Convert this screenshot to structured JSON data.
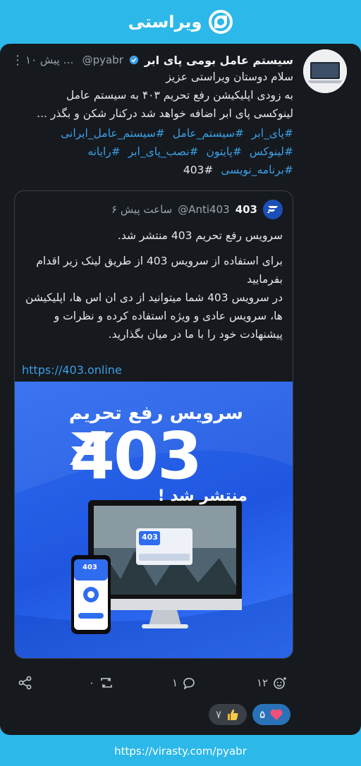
{
  "brand": {
    "name": "ویراستی"
  },
  "post": {
    "author": "سیستم عامل بومی پای ابر",
    "handle": "@pyabr",
    "time": "۱۰ ساعت پیش",
    "more_icon": "more-vertical-icon",
    "body_lines": [
      "سلام دوستان ویراستی عزیز",
      "به زودی اپلیکیشن رفع تحریم ۴۰۳ به سیستم عامل",
      "لینوکسی پای ابر اضافه خواهد شد درکنار شکن و بگذر ..."
    ],
    "hashtags": [
      "#پای_ابر",
      "#سیستم_عامل",
      "#سیستم_عامل_ایرانی",
      "#لینوکس",
      "#پایتون",
      "#نصب_پای_ابر",
      "#رایانه",
      "#برنامه_نویسی"
    ],
    "last_tag": "#403"
  },
  "quote": {
    "name": "403",
    "handle": "@Anti403",
    "time": "۶ ساعت پیش",
    "headline": "سرویس رفع تحریم 403 منتشر شد.",
    "para1": "برای استفاده از سرویس 403  از  طریق  لینک زیر اقدام بفرمایید",
    "para2": "در سرویس 403 شما میتوانید از دی ان اس ها، اپلیکیشن ها، سرویس عادی و ویژه استفاده کرده و نظرات و پیشنهادت خود را با ما در میان بگذارید.",
    "link": "https://403.online",
    "image": {
      "title": "سرویس رفع تحریم",
      "big_text": "403",
      "subtitle": "منتشر شد !",
      "screen_logo": "403",
      "phone_logo": "403"
    }
  },
  "actions": {
    "reply_count": "۱",
    "repost_count": "۰",
    "like_count": "۱۲"
  },
  "reactions": {
    "heart_count": "۵",
    "thumb_count": "۷"
  },
  "footer": {
    "url": "https://virasty.com/pyabr"
  },
  "colors": {
    "accent": "#2cb8e8",
    "link": "#3aa0e6",
    "card": "#16191e"
  }
}
